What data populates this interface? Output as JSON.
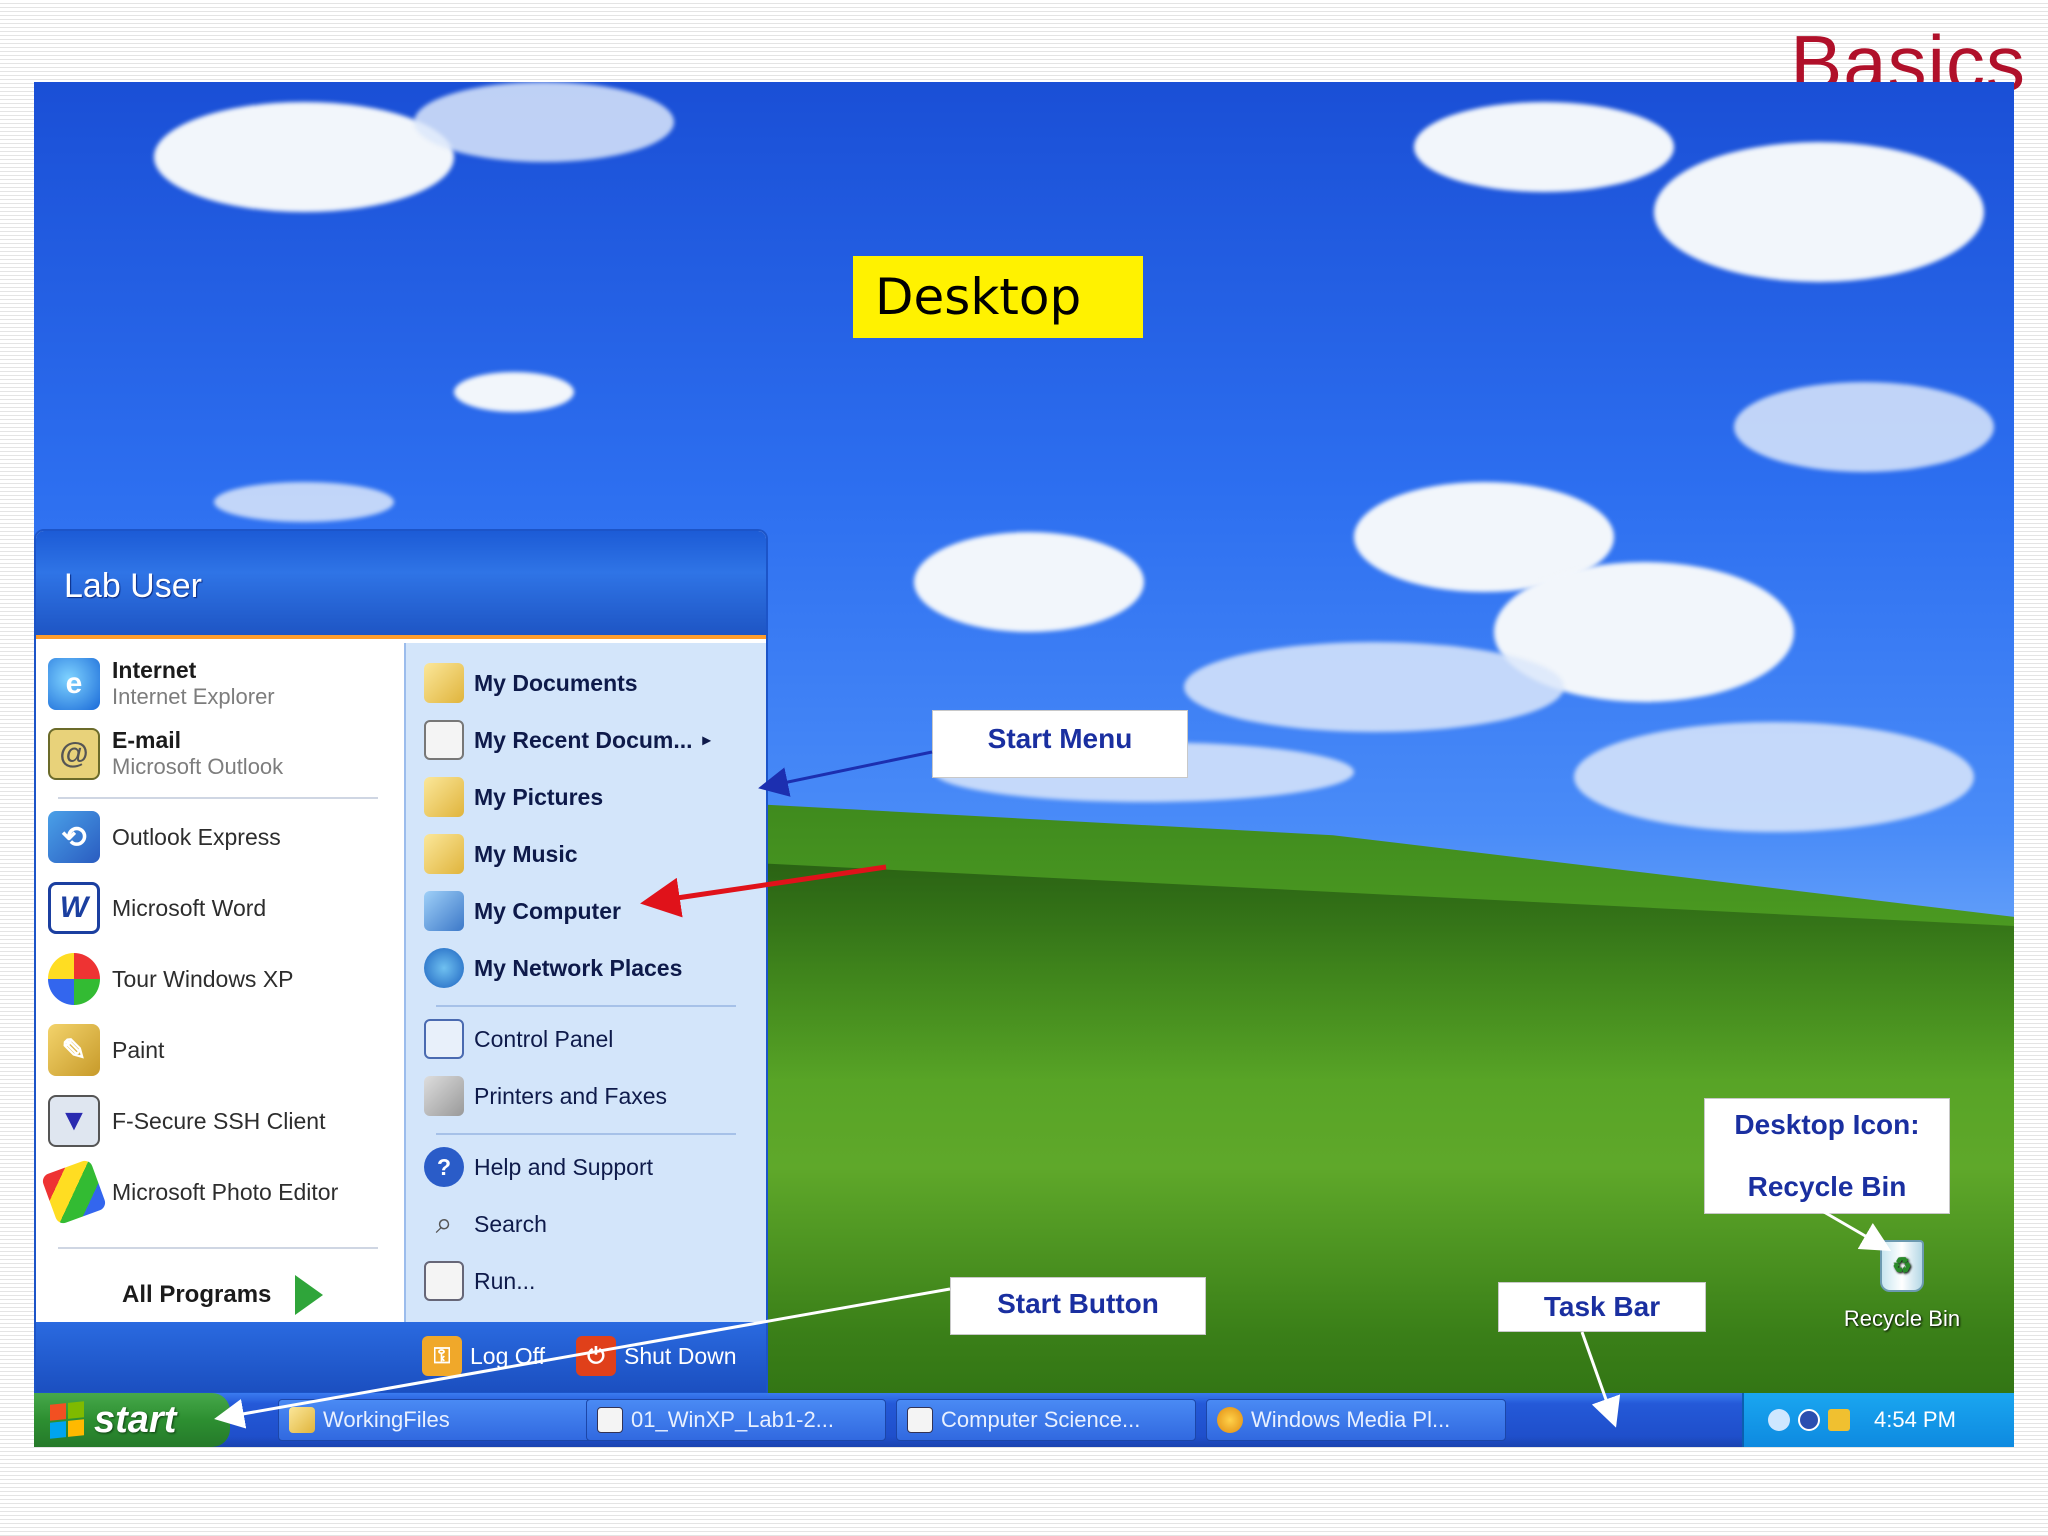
{
  "slide": {
    "title": "Basics"
  },
  "labels": {
    "desktop": "Desktop",
    "start_menu": "Start Menu",
    "start_button": "Start Button",
    "task_bar": "Task Bar",
    "desktop_icon_line1": "Desktop Icon:",
    "desktop_icon_line2": "Recycle Bin"
  },
  "start_menu": {
    "user": "Lab User",
    "pinned": [
      {
        "title": "Internet",
        "subtitle": "Internet Explorer",
        "icon": "internet-explorer-icon"
      },
      {
        "title": "E-mail",
        "subtitle": "Microsoft Outlook",
        "icon": "outlook-icon"
      }
    ],
    "recent": [
      {
        "label": "Outlook Express",
        "icon": "outlook-express-icon"
      },
      {
        "label": "Microsoft Word",
        "icon": "word-icon"
      },
      {
        "label": "Tour Windows XP",
        "icon": "tour-icon"
      },
      {
        "label": "Paint",
        "icon": "paint-icon"
      },
      {
        "label": "F-Secure SSH Client",
        "icon": "ssh-client-icon"
      },
      {
        "label": "Microsoft Photo Editor",
        "icon": "photo-editor-icon"
      }
    ],
    "all_programs": "All Programs",
    "places": [
      {
        "label": "My Documents",
        "icon": "folder-icon"
      },
      {
        "label": "My Recent Docum...",
        "icon": "recent-docs-icon"
      },
      {
        "label": "My Pictures",
        "icon": "folder-icon"
      },
      {
        "label": "My Music",
        "icon": "folder-icon"
      },
      {
        "label": "My Computer",
        "icon": "computer-icon"
      },
      {
        "label": "My Network Places",
        "icon": "network-icon"
      }
    ],
    "system": [
      {
        "label": "Control Panel",
        "icon": "control-panel-icon"
      },
      {
        "label": "Printers and Faxes",
        "icon": "printer-icon"
      }
    ],
    "support": [
      {
        "label": "Help and Support",
        "icon": "help-icon"
      },
      {
        "label": "Search",
        "icon": "search-icon"
      },
      {
        "label": "Run...",
        "icon": "run-icon"
      }
    ],
    "log_off": "Log Off",
    "shut_down": "Shut Down"
  },
  "taskbar": {
    "start": "start",
    "tasks": [
      {
        "label": "WorkingFiles",
        "icon": "folder-icon"
      },
      {
        "label": "01_WinXP_Lab1-2...",
        "icon": "document-icon"
      },
      {
        "label": "Computer Science...",
        "icon": "document-icon"
      },
      {
        "label": "Windows Media Pl...",
        "icon": "media-player-icon"
      }
    ],
    "clock": "4:54 PM"
  },
  "desktop_icons": [
    {
      "label": "Recycle Bin",
      "icon": "recycle-bin-icon"
    }
  ],
  "colors": {
    "title": "#b0102a",
    "desktop_label_bg": "#fff200",
    "callout_text": "#1a2fa0",
    "annotation_arrow_red": "#e0121a",
    "annotation_arrow_blue": "#1c2fb0"
  }
}
